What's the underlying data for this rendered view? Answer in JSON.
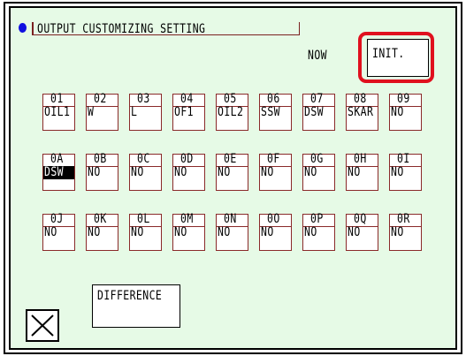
{
  "header": {
    "title": "OUTPUT CUSTOMIZING SETTING"
  },
  "status": {
    "now_label": "NOW"
  },
  "buttons": {
    "init_label": "INIT.",
    "difference_label": "DIFFERENCE"
  },
  "colors": {
    "background": "#e6fae6",
    "highlight": "#e0101e",
    "indicator": "#1010e0"
  },
  "outputs": [
    {
      "code": "01",
      "value": "OIL1"
    },
    {
      "code": "02",
      "value": "W"
    },
    {
      "code": "03",
      "value": "L"
    },
    {
      "code": "04",
      "value": "OF1"
    },
    {
      "code": "05",
      "value": "OIL2"
    },
    {
      "code": "06",
      "value": "SSW"
    },
    {
      "code": "07",
      "value": "DSW"
    },
    {
      "code": "08",
      "value": "SKAR"
    },
    {
      "code": "09",
      "value": "NO"
    },
    {
      "code": "0A",
      "value": "DSW",
      "selected": true
    },
    {
      "code": "0B",
      "value": "NO"
    },
    {
      "code": "0C",
      "value": "NO"
    },
    {
      "code": "0D",
      "value": "NO"
    },
    {
      "code": "0E",
      "value": "NO"
    },
    {
      "code": "0F",
      "value": "NO"
    },
    {
      "code": "0G",
      "value": "NO"
    },
    {
      "code": "0H",
      "value": "NO"
    },
    {
      "code": "0I",
      "value": "NO"
    },
    {
      "code": "0J",
      "value": "NO"
    },
    {
      "code": "0K",
      "value": "NO"
    },
    {
      "code": "0L",
      "value": "NO"
    },
    {
      "code": "0M",
      "value": "NO"
    },
    {
      "code": "0N",
      "value": "NO"
    },
    {
      "code": "0O",
      "value": "NO"
    },
    {
      "code": "0P",
      "value": "NO"
    },
    {
      "code": "0Q",
      "value": "NO"
    },
    {
      "code": "0R",
      "value": "NO"
    }
  ],
  "icons": {
    "close": "close-icon"
  }
}
